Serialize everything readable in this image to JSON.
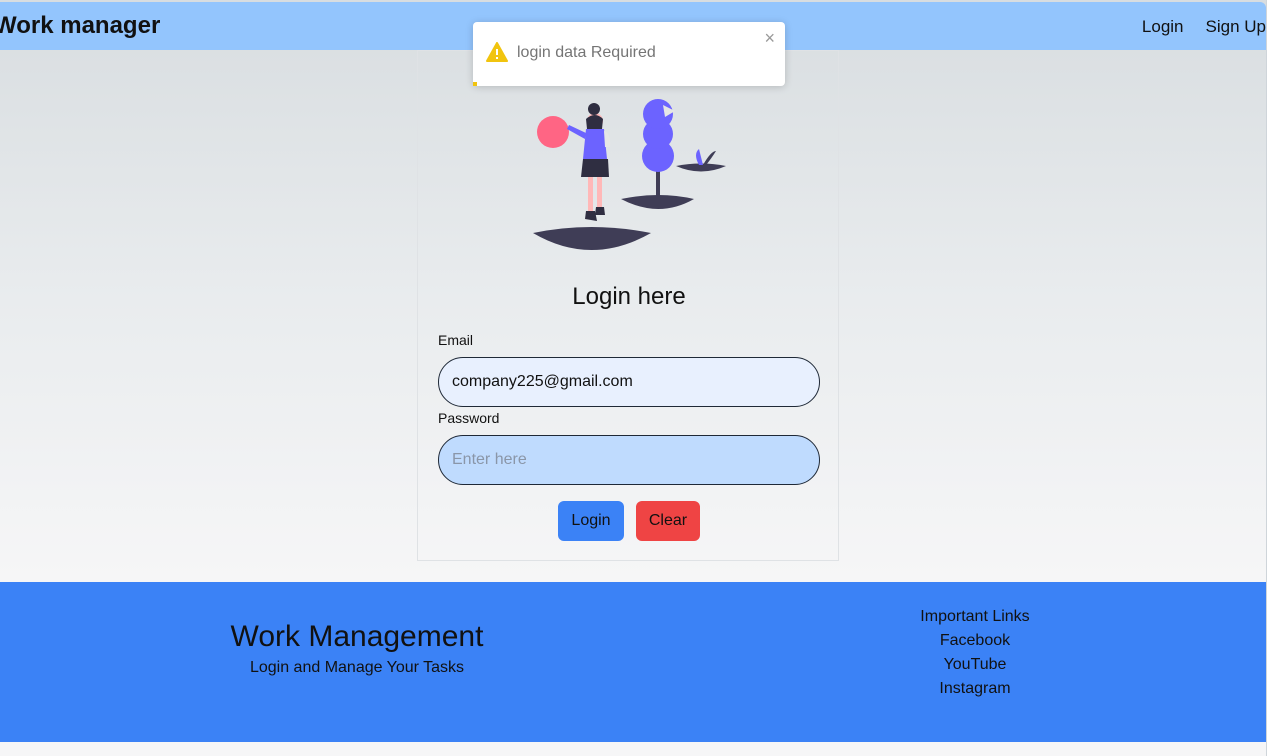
{
  "navbar": {
    "brand": "Work manager",
    "links": [
      "Login",
      "Sign Up"
    ]
  },
  "toast": {
    "message": "login data Required",
    "close_glyph": "×",
    "icon": "warning-icon",
    "color": "#f1c40f"
  },
  "login": {
    "title": "Login here",
    "email_label": "Email",
    "email_value": "company225@gmail.com",
    "password_label": "Password",
    "password_placeholder": "Enter here",
    "login_button": "Login",
    "clear_button": "Clear"
  },
  "footer": {
    "title": "Work Management",
    "subtitle": "Login and Manage Your Tasks",
    "links_heading": "Important Links",
    "links": [
      "Facebook",
      "YouTube",
      "Instagram"
    ]
  },
  "colors": {
    "navbar": "#93c5fd",
    "footer": "#3b82f6",
    "login_button": "#3b82f6",
    "clear_button": "#ef4444",
    "illustration_accent": "#6c63ff",
    "illustration_ball": "#ff6584"
  }
}
